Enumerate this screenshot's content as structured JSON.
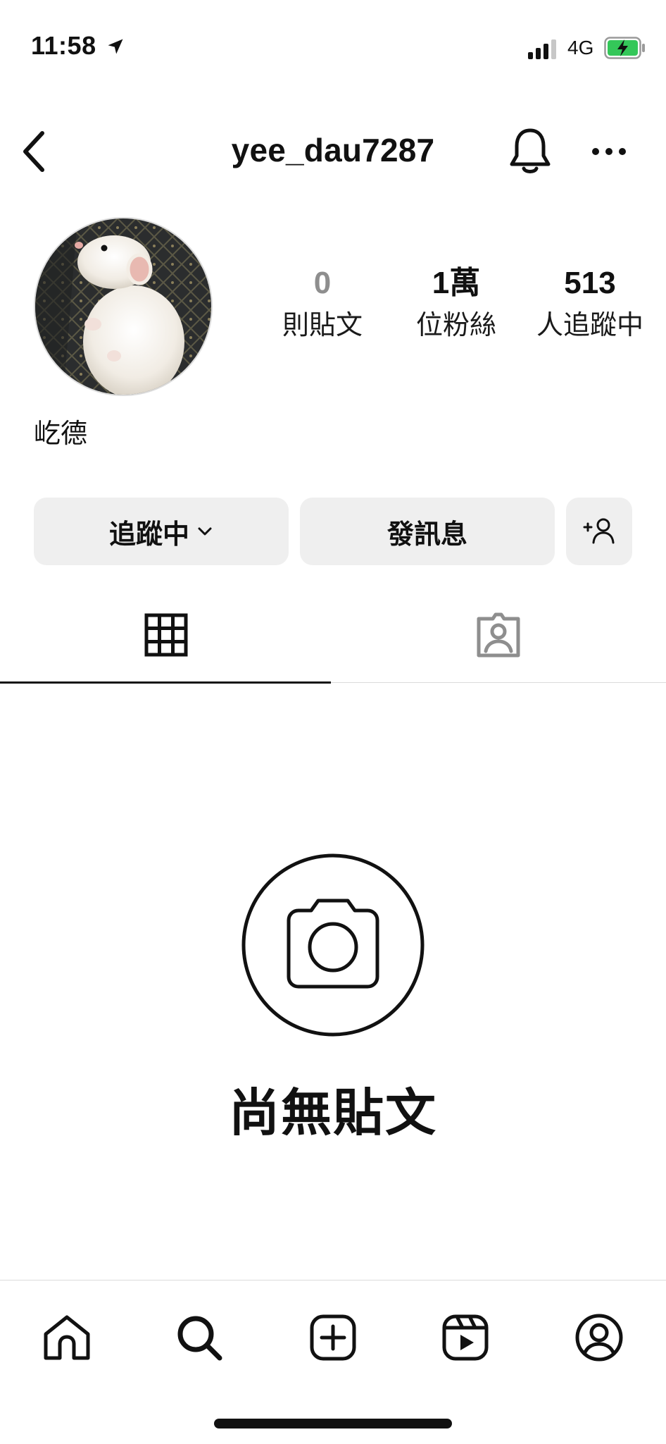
{
  "status_bar": {
    "time": "11:58",
    "network": "4G",
    "icons": [
      "location-arrow-icon",
      "signal-icon",
      "battery-charging-icon"
    ]
  },
  "header": {
    "username": "yee_dau7287",
    "icons": [
      "back-chevron-icon",
      "bell-icon",
      "more-horizontal-icon"
    ]
  },
  "profile": {
    "display_name": "屹德",
    "stats": {
      "posts": {
        "value": "0",
        "label": "則貼文"
      },
      "followers": {
        "value": "1萬",
        "label": "位粉絲"
      },
      "following": {
        "value": "513",
        "label": "人追蹤中"
      }
    }
  },
  "actions": {
    "following_label": "追蹤中",
    "message_label": "發訊息",
    "add_user_icon": "add-person-icon"
  },
  "tabs": [
    {
      "name": "posts-grid",
      "icon": "grid-icon",
      "active": true
    },
    {
      "name": "tagged",
      "icon": "tagged-person-icon",
      "active": false
    }
  ],
  "empty_state": {
    "title": "尚無貼文",
    "icon": "camera-circle-icon"
  },
  "bottom_nav": {
    "items": [
      "home-icon",
      "search-icon",
      "create-plus-icon",
      "reels-icon",
      "profile-icon"
    ],
    "active": "profile-icon"
  },
  "colors": {
    "text": "#111111",
    "muted": "#8e8e8e",
    "button_bg": "#efefef",
    "divider": "#dbdbdb"
  }
}
